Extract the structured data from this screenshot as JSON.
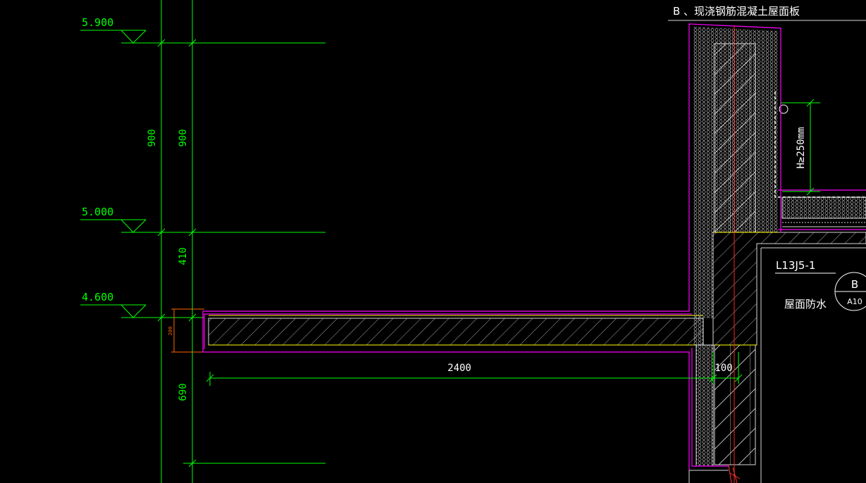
{
  "drawing": {
    "title": "B 、现浇钢筋混凝土屋面板",
    "levels": [
      "5.900",
      "5.000",
      "4.600"
    ],
    "dimensions_vertical": {
      "upper_left": "900",
      "upper_right": "900",
      "mid": "410",
      "lower": "690",
      "slab_small": "200"
    },
    "dimensions_horizontal": {
      "overhang": "2400",
      "wall": "100"
    },
    "parapet_height": "H≥250mm",
    "detail_ref": {
      "code": "L13J5-1",
      "label": "屋面防水",
      "bubble_top": "B",
      "bubble_bottom": "A10"
    }
  },
  "colors": {
    "background": "#000000",
    "dimension_line": "#00ff00",
    "membrane": "#ff00ff",
    "section": "#ffffff",
    "insulation": "#ffff00",
    "axis": "#ff0000",
    "leader": "#ff6600"
  }
}
